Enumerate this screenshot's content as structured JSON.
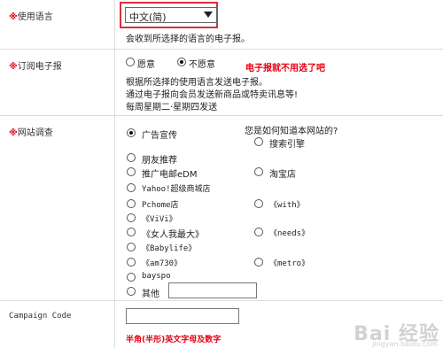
{
  "language": {
    "label": "使用语言",
    "required_mark": "※",
    "selected": "中文(简)",
    "note": "会收到所选择的语言的电子报。"
  },
  "newsletter": {
    "label": "订阅电子报",
    "required_mark": "※",
    "options": [
      "愿意",
      "不愿意"
    ],
    "selected": "不愿意",
    "annotation": "电子报就不用选了吧",
    "desc": [
      "根据所选择的使用语言发送电子报。",
      "通过电子报向会员发送新商品或特卖讯息等!",
      "每周星期二·星期四发送"
    ]
  },
  "survey": {
    "label": "网站调查",
    "required_mark": "※",
    "question": "您是如何知道本网站的?",
    "options": {
      "ad": "广告宣传",
      "search": "搜索引擎",
      "friend": "朋友推荐",
      "dm": "推广电邮eDM",
      "taobao": "淘宝店",
      "yahoo": "Yahoo!超级商城店",
      "pchome": "Pchome店",
      "with": "《with》",
      "vivi": "《ViVi》",
      "needs": "《needs》",
      "woman": "《女人我最大》",
      "babylife": "《Babylife》",
      "am730": "《am730》",
      "metro": "《metro》",
      "bayspo": "bayspo",
      "other": "其他"
    },
    "selected": "ad",
    "other_value": ""
  },
  "campaign": {
    "label": "Campaign Code",
    "value": "",
    "hint": "半角(半形)英文字母及数字"
  },
  "watermark": {
    "text": "Bai 经验",
    "sub": "jingyan.baidu.com"
  }
}
